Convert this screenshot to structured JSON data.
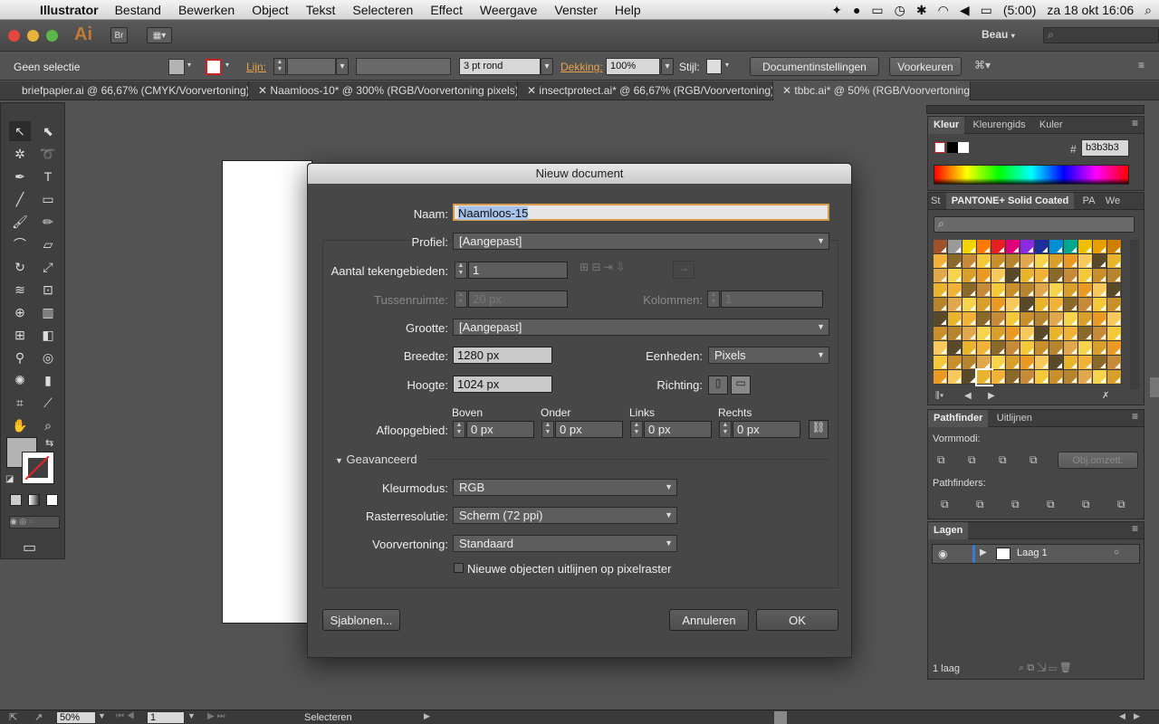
{
  "menubar": {
    "app_name": "Illustrator",
    "items": [
      "Bestand",
      "Bewerken",
      "Object",
      "Tekst",
      "Selecteren",
      "Effect",
      "Weergave",
      "Venster",
      "Help"
    ],
    "battery": "(5:00)",
    "datetime": "za 18 okt  16:06"
  },
  "appbar": {
    "logo": "Ai",
    "bridge": "Br",
    "workspace": "Beau"
  },
  "control": {
    "selection": "Geen selectie",
    "stroke_label": "Lijn:",
    "stroke_style": "3 pt rond",
    "opacity_label": "Dekking:",
    "opacity_value": "100%",
    "style_label": "Stijl:",
    "doc_settings": "Documentinstellingen",
    "preferences": "Voorkeuren"
  },
  "tabs": [
    {
      "label": "briefpapier.ai @ 66,67% (CMYK/Voorvertoning)"
    },
    {
      "label": "Naamloos-10* @ 300% (RGB/Voorvertoning pixels)"
    },
    {
      "label": "insectprotect.ai* @ 66,67% (RGB/Voorvertoning)"
    },
    {
      "label": "tbbc.ai* @ 50% (RGB/Voorvertoning)"
    }
  ],
  "color_panel": {
    "tabs": [
      "Kleur",
      "Kleurengids",
      "Kuler"
    ],
    "hex_label": "#",
    "hex_value": "b3b3b3"
  },
  "swatch_panel": {
    "tabs": [
      "St",
      "PANTONE+ Solid Coated",
      "PA",
      "We"
    ]
  },
  "pathfinder_panel": {
    "tabs": [
      "Pathfinder",
      "Uitlijnen"
    ],
    "shape_modes": "Vormmodi:",
    "expand": "Obj.omzett.",
    "pathfinders": "Pathfinders:"
  },
  "layers_panel": {
    "tab": "Lagen",
    "layer_name": "Laag 1",
    "count": "1 laag"
  },
  "dialog": {
    "title": "Nieuw document",
    "name_label": "Naam:",
    "name_value": "Naamloos-15",
    "profile_label": "Profiel:",
    "profile_value": "[Aangepast]",
    "artboards_label": "Aantal tekengebieden:",
    "artboards_value": "1",
    "spacing_label": "Tussenruimte:",
    "spacing_value": "20 px",
    "columns_label": "Kolommen:",
    "columns_value": "1",
    "size_label": "Grootte:",
    "size_value": "[Aangepast]",
    "width_label": "Breedte:",
    "width_value": "1280 px",
    "units_label": "Eenheden:",
    "units_value": "Pixels",
    "height_label": "Hoogte:",
    "height_value": "1024 px",
    "orientation_label": "Richting:",
    "bleed_label": "Afloopgebied:",
    "bleed_top_label": "Boven",
    "bleed_top": "0 px",
    "bleed_bottom_label": "Onder",
    "bleed_bottom": "0 px",
    "bleed_left_label": "Links",
    "bleed_left": "0 px",
    "bleed_right_label": "Rechts",
    "bleed_right": "0 px",
    "advanced_label": "Geavanceerd",
    "color_mode_label": "Kleurmodus:",
    "color_mode_value": "RGB",
    "raster_label": "Rasterresolutie:",
    "raster_value": "Scherm (72 ppi)",
    "preview_label": "Voorvertoning:",
    "preview_value": "Standaard",
    "align_pixel_label": "Nieuwe objecten uitlijnen op pixelraster",
    "templates_button": "Sjablonen...",
    "cancel_button": "Annuleren",
    "ok_button": "OK"
  },
  "statusbar": {
    "zoom": "50%",
    "page": "1",
    "tool": "Selecteren"
  },
  "colors": {
    "accent_orange": "#e8a24a",
    "ui_bg": "#535353",
    "panel_bg": "#464646"
  }
}
